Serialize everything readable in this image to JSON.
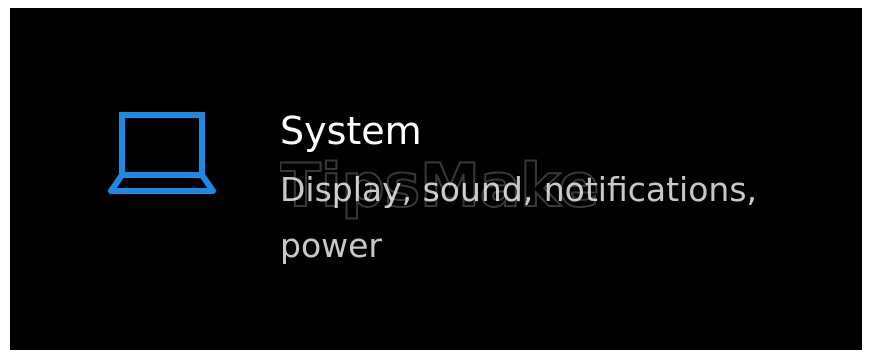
{
  "tile": {
    "icon": "laptop-icon",
    "title": "System",
    "subtitle": "Display, sound, notifications, power"
  },
  "colors": {
    "background": "#000000",
    "icon_accent": "#1e88e5",
    "title": "#ffffff",
    "subtitle": "#c8c8c8"
  }
}
